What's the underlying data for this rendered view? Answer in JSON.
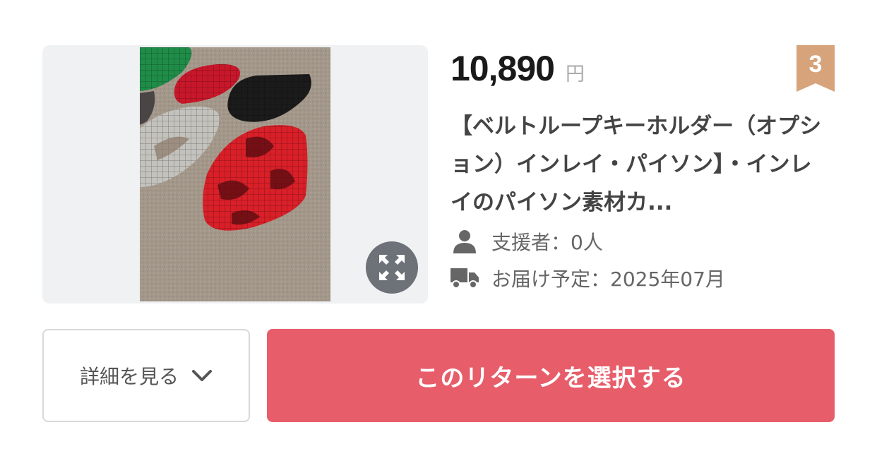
{
  "reward": {
    "price": "10,890",
    "currency": "円",
    "rank": "3",
    "title": "【ベルトループキーホルダー（オプション）インレイ・パイソン】・インレイのパイソン素材カ...",
    "supporters": "支援者：0人",
    "delivery": "お届け予定：2025年07月"
  },
  "buttons": {
    "details_label": "詳細を見る",
    "select_label": "このリターンを選択する"
  },
  "icons": {
    "expand": "expand-icon",
    "supporters": "person-icon",
    "delivery": "truck-icon",
    "chevron": "chevron-down-icon",
    "rank": "bookmark-ribbon-icon"
  },
  "colors": {
    "accent": "#e75d6a",
    "rank_badge": "#d6a37a",
    "thumb_bg": "#eff1f3"
  }
}
